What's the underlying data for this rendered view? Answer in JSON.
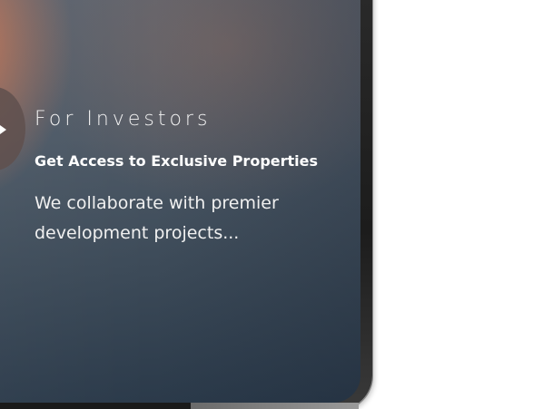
{
  "card": {
    "kicker": "For Investors",
    "headline": "Get Access to Exclusive Properties",
    "body": "We collaborate with premier development projects..."
  },
  "icons": {
    "play": "play-icon"
  },
  "colors": {
    "screen_top": "#5b6470",
    "screen_bottom": "#2b3a4a",
    "accent_glow": "#cd7850",
    "bezel": "#1c1c1c",
    "text": "#ffffff"
  }
}
